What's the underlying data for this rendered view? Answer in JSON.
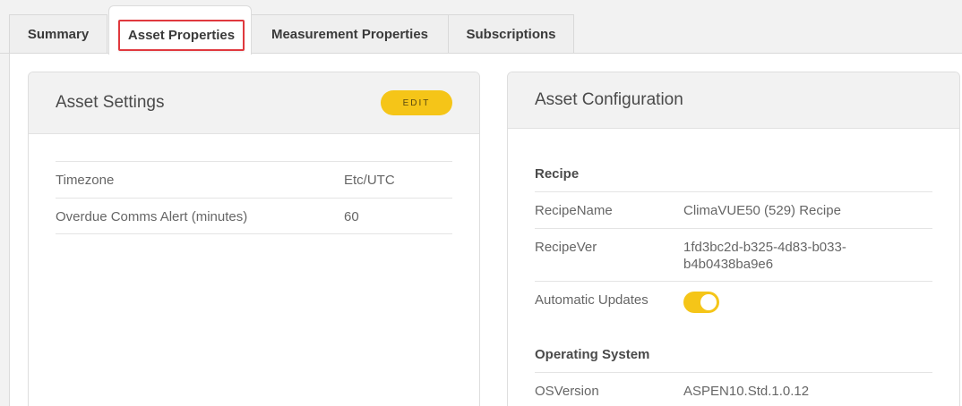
{
  "tabs": [
    {
      "label": "Summary",
      "active": false
    },
    {
      "label": "Asset Properties",
      "active": true
    },
    {
      "label": "Measurement Properties",
      "active": false
    },
    {
      "label": "Subscriptions",
      "active": false
    }
  ],
  "asset_settings": {
    "title": "Asset Settings",
    "edit_label": "EDIT",
    "rows": [
      {
        "key": "Timezone",
        "value": "Etc/UTC"
      },
      {
        "key": "Overdue Comms Alert (minutes)",
        "value": "60"
      }
    ]
  },
  "asset_configuration": {
    "title": "Asset Configuration",
    "recipe": {
      "heading": "Recipe",
      "recipe_name_key": "RecipeName",
      "recipe_name_value": "ClimaVUE50 (529) Recipe",
      "recipe_ver_key": "RecipeVer",
      "recipe_ver_line1": "1fd3bc2d-b325-4d83-b033-",
      "recipe_ver_line2": "b4b0438ba9e6",
      "auto_updates_key": "Automatic Updates",
      "auto_updates_on": true
    },
    "os": {
      "heading": "Operating System",
      "os_version_key": "OSVersion",
      "os_version_value": "ASPEN10.Std.1.0.12"
    }
  },
  "colors": {
    "accent_yellow": "#f5c518",
    "highlight_red": "#e0393e"
  }
}
